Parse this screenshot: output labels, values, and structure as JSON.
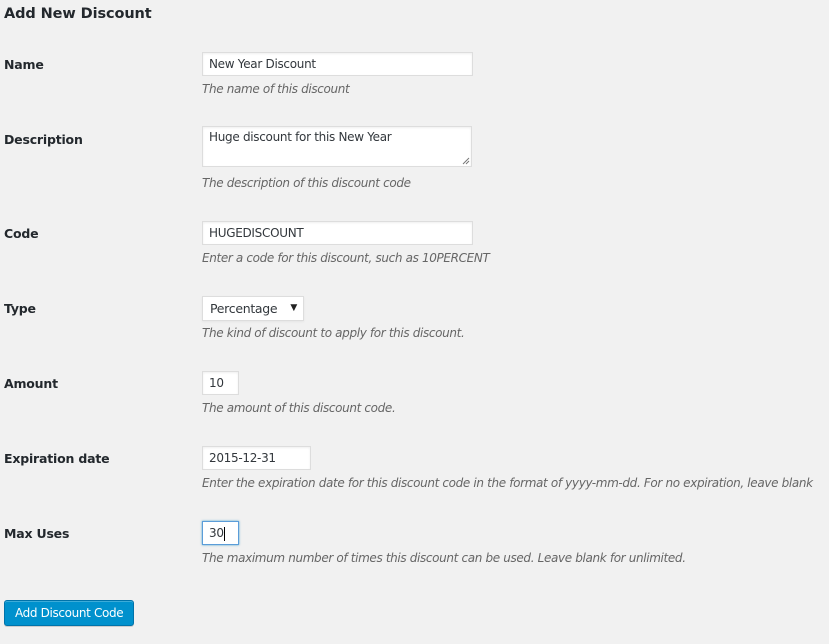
{
  "page": {
    "title": "Add New Discount"
  },
  "form": {
    "name": {
      "label": "Name",
      "value": "New Year Discount",
      "description": "The name of this discount"
    },
    "description": {
      "label": "Description",
      "value": "Huge discount for this New Year",
      "description": "The description of this discount code"
    },
    "code": {
      "label": "Code",
      "value": "HUGEDISCOUNT",
      "description": "Enter a code for this discount, such as 10PERCENT"
    },
    "type": {
      "label": "Type",
      "selected": "Percentage",
      "description": "The kind of discount to apply for this discount."
    },
    "amount": {
      "label": "Amount",
      "value": "10",
      "description": "The amount of this discount code."
    },
    "expiration": {
      "label": "Expiration date",
      "value": "2015-12-31",
      "description": "Enter the expiration date for this discount code in the format of yyyy-mm-dd. For no expiration, leave blank"
    },
    "max_uses": {
      "label": "Max Uses",
      "value": "30",
      "description": "The maximum number of times this discount can be used. Leave blank for unlimited."
    },
    "submit_label": "Add Discount Code"
  },
  "colors": {
    "background": "#f1f1f1",
    "primary_button": "#0091cd",
    "focus_border": "#5b9dd9"
  }
}
